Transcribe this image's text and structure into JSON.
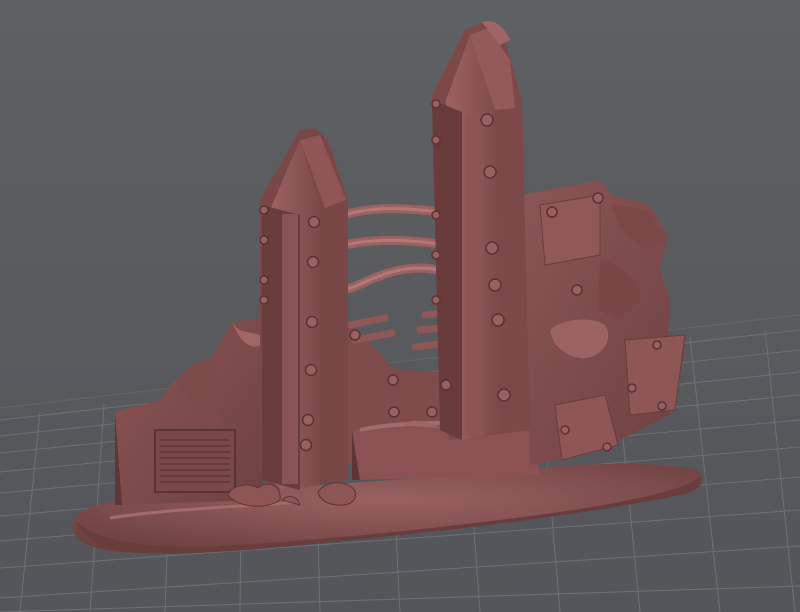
{
  "viewport": {
    "background_top": "#5e6063",
    "background_bottom": "#54565a",
    "grid_color": "#6f7276",
    "grid_major_color": "#7b7e82"
  },
  "model": {
    "material_color": "#8a5454",
    "highlight_color": "#a86a6a",
    "shadow_color": "#5e3434",
    "icon": "3d-terrain-ruin-model"
  }
}
